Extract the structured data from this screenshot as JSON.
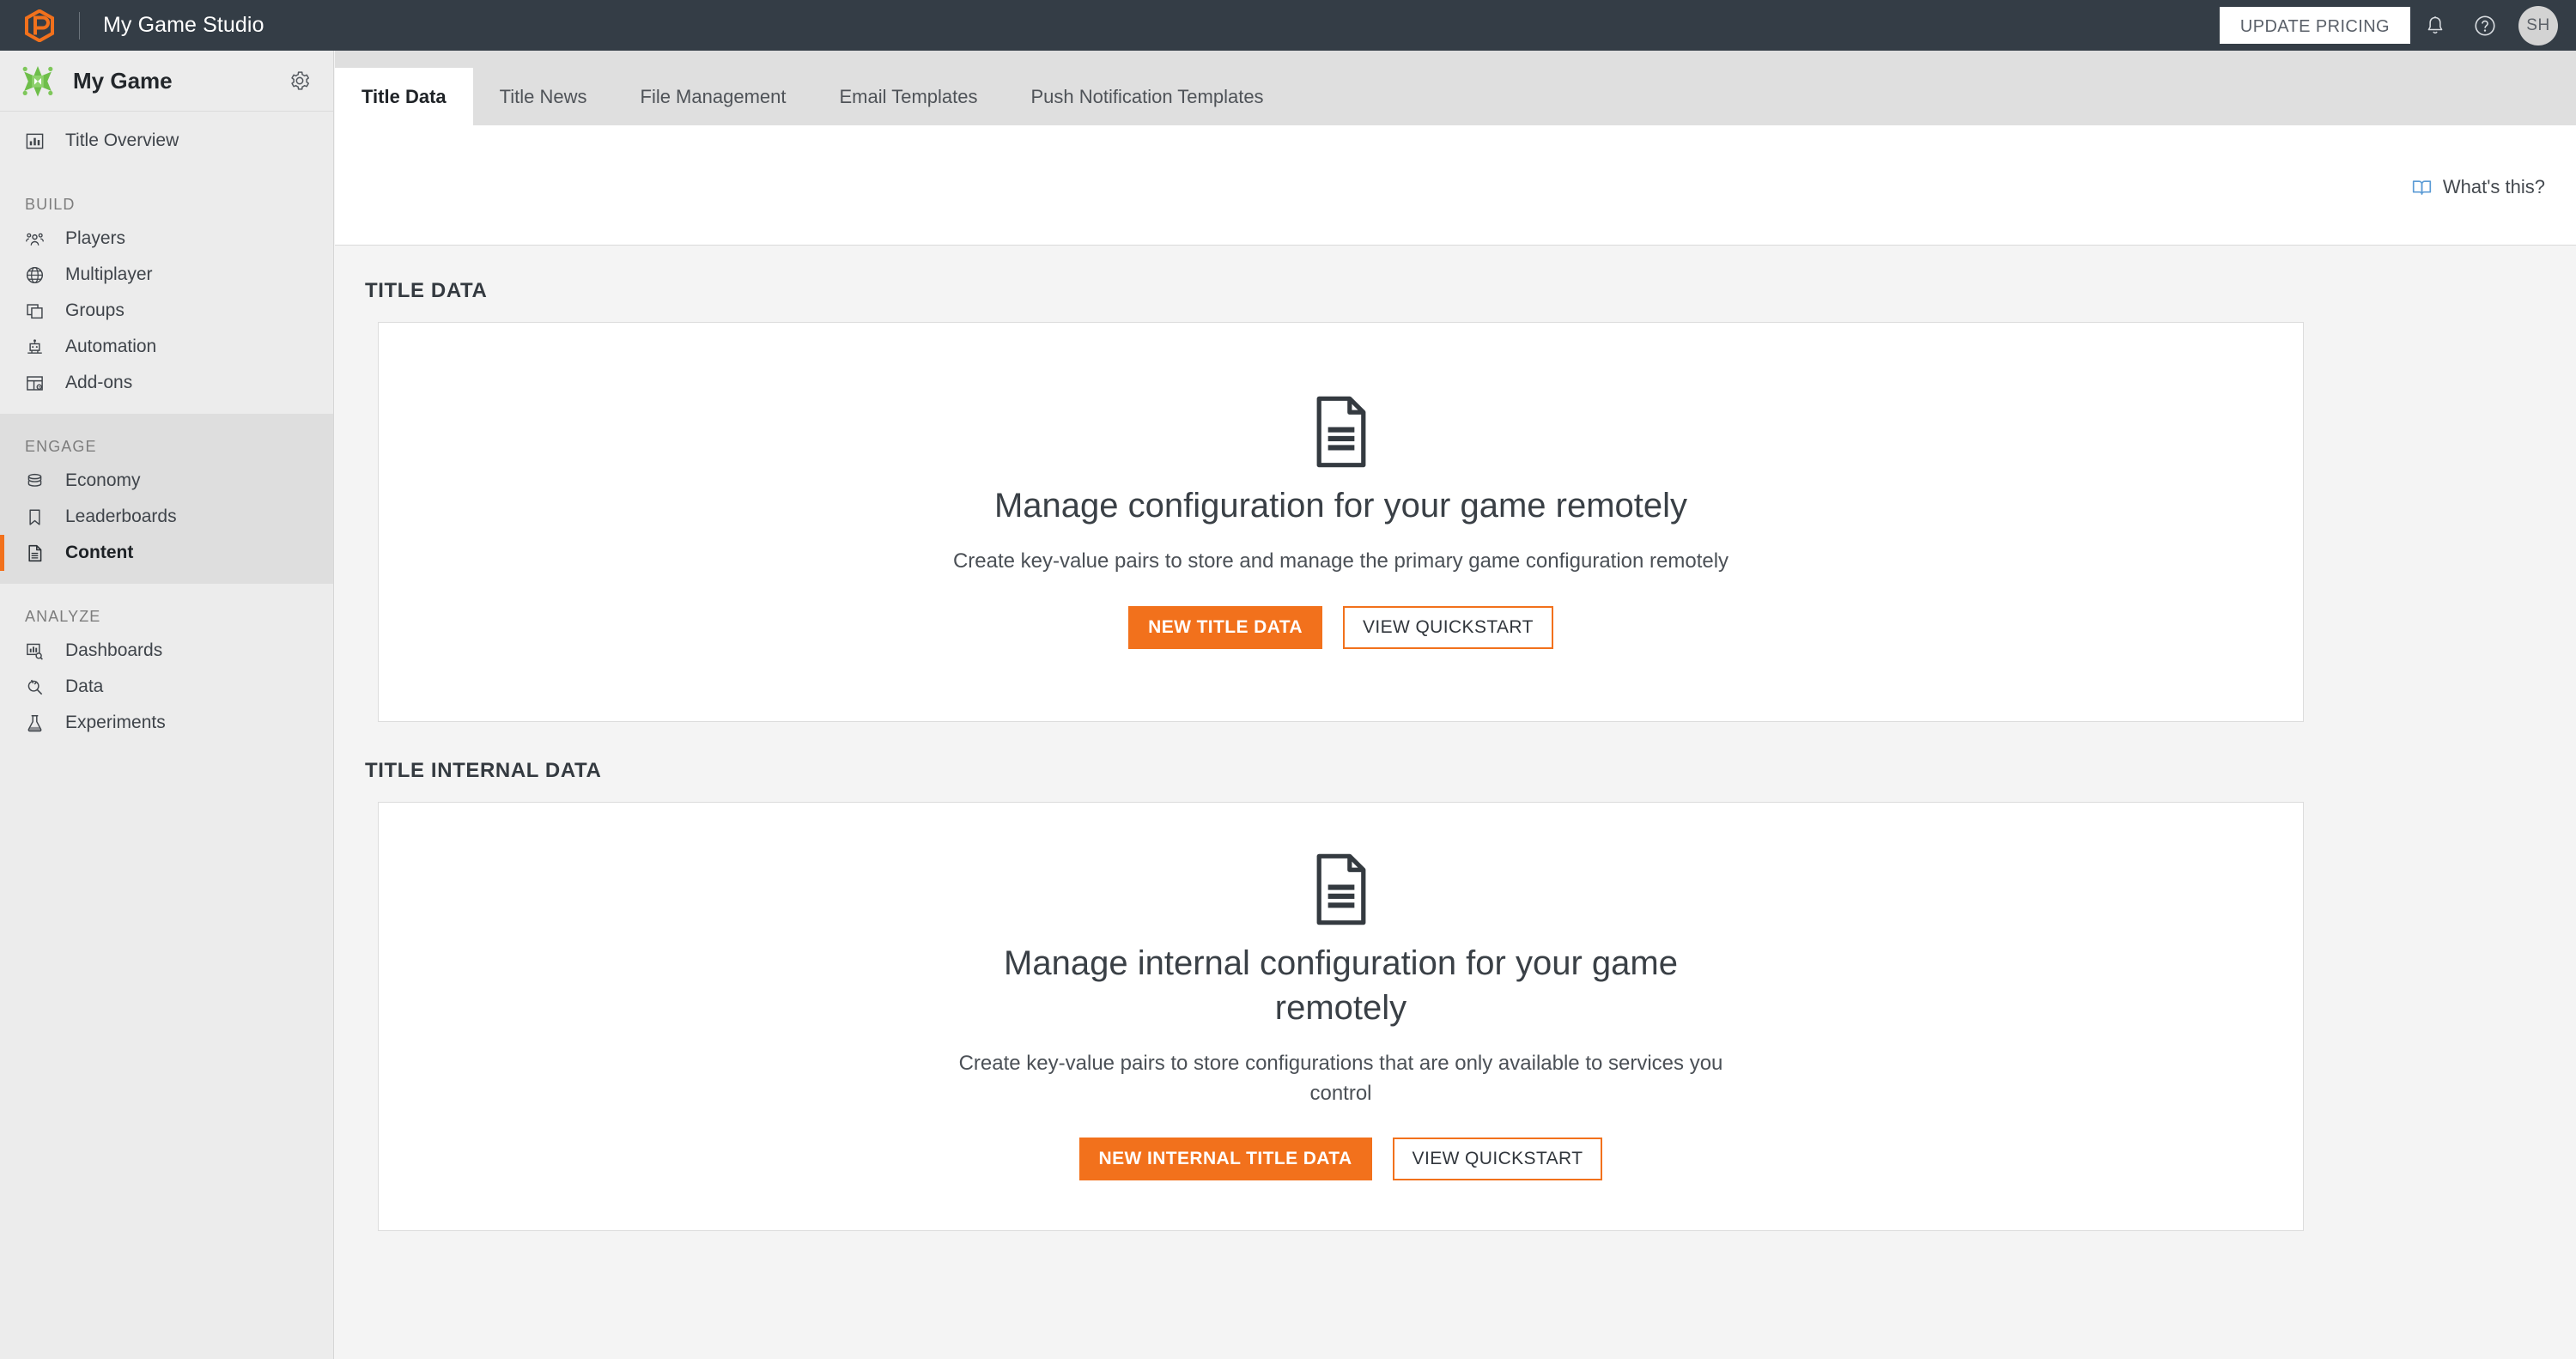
{
  "topbar": {
    "logo_icon": "playfab-hexagon-logo",
    "studio_name": "My Game Studio",
    "update_pricing_label": "UPDATE PRICING",
    "notifications_icon": "bell-icon",
    "help_icon": "question-circle-icon",
    "avatar_initials": "SH",
    "background_color": "#343d46",
    "accent_color": "#f2711c"
  },
  "sidebar": {
    "game_title": "My Game",
    "game_icon": "green-game-burst-icon",
    "settings_icon": "gear-icon",
    "top_items": [
      {
        "label": "Title Overview",
        "icon": "bar-chart-icon"
      }
    ],
    "groups": [
      {
        "label": "BUILD",
        "active": false,
        "items": [
          {
            "label": "Players",
            "icon": "people-icon"
          },
          {
            "label": "Multiplayer",
            "icon": "globe-icon"
          },
          {
            "label": "Groups",
            "icon": "copy-stack-icon"
          },
          {
            "label": "Automation",
            "icon": "robot-icon"
          },
          {
            "label": "Add-ons",
            "icon": "layout-gear-icon"
          }
        ]
      },
      {
        "label": "ENGAGE",
        "active": true,
        "items": [
          {
            "label": "Economy",
            "icon": "database-coins-icon"
          },
          {
            "label": "Leaderboards",
            "icon": "bookmark-icon"
          },
          {
            "label": "Content",
            "icon": "document-icon",
            "selected": true
          }
        ]
      },
      {
        "label": "ANALYZE",
        "active": false,
        "items": [
          {
            "label": "Dashboards",
            "icon": "chart-search-icon"
          },
          {
            "label": "Data",
            "icon": "plug-icon"
          },
          {
            "label": "Experiments",
            "icon": "flask-icon"
          }
        ]
      }
    ]
  },
  "tabs": [
    {
      "label": "Title Data",
      "active": true
    },
    {
      "label": "Title News",
      "active": false
    },
    {
      "label": "File Management",
      "active": false
    },
    {
      "label": "Email Templates",
      "active": false
    },
    {
      "label": "Push Notification Templates",
      "active": false
    }
  ],
  "whats_this": {
    "label": "What's this?",
    "icon": "book-icon",
    "icon_color": "#5b9bd5"
  },
  "sections": [
    {
      "heading": "TITLE DATA",
      "card": {
        "icon": "document-icon",
        "title": "Manage configuration for your game remotely",
        "description": "Create key-value pairs to store and manage the primary game configuration remotely",
        "primary_button": "NEW TITLE DATA",
        "secondary_button": "VIEW QUICKSTART"
      }
    },
    {
      "heading": "TITLE INTERNAL DATA",
      "card": {
        "icon": "document-icon",
        "title": "Manage internal configuration for your game remotely",
        "description": "Create key-value pairs to store configurations that are only available to services you control",
        "primary_button": "NEW INTERNAL TITLE DATA",
        "secondary_button": "VIEW QUICKSTART"
      }
    }
  ]
}
